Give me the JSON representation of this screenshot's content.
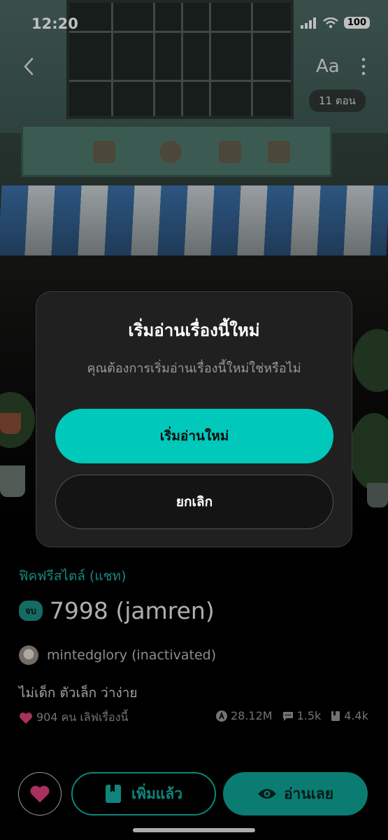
{
  "status_bar": {
    "time": "12:20",
    "battery": "100"
  },
  "top_nav": {
    "font_button": "Aa",
    "episodes_badge": "11 ตอน"
  },
  "dialog": {
    "title": "เริ่มอ่านเรื่องนี้ใหม่",
    "message": "คุณต้องการเริ่มอ่านเรื่องนี้ใหม่ใช่หรือไม่",
    "confirm_label": "เริ่มอ่านใหม่",
    "cancel_label": "ยกเลิก"
  },
  "story": {
    "genre": "ฟิคฟรีสไตล์ (แชท)",
    "status_badge": "จบ",
    "title": "7998 (jamren)",
    "author": "mintedglory (inactivated)",
    "tagline": "ไม่เด็ก ตัวเล็ก ว่าง่าย",
    "likes_text": "904 คน เลิฟเรื่องนี้",
    "views": "28.12M",
    "comments": "1.5k",
    "bookmarks": "4.4k"
  },
  "actions": {
    "added_label": "เพิ่มแล้ว",
    "read_label": "อ่านเลย"
  },
  "colors": {
    "accent": "#00c9bb",
    "like": "#e0427a",
    "genre": "#1fb5a8"
  },
  "icons": [
    "back-icon",
    "font-size-icon",
    "more-icon",
    "heart-icon",
    "book-icon",
    "eye-icon",
    "views-icon",
    "comment-icon",
    "bookmark-icon"
  ]
}
